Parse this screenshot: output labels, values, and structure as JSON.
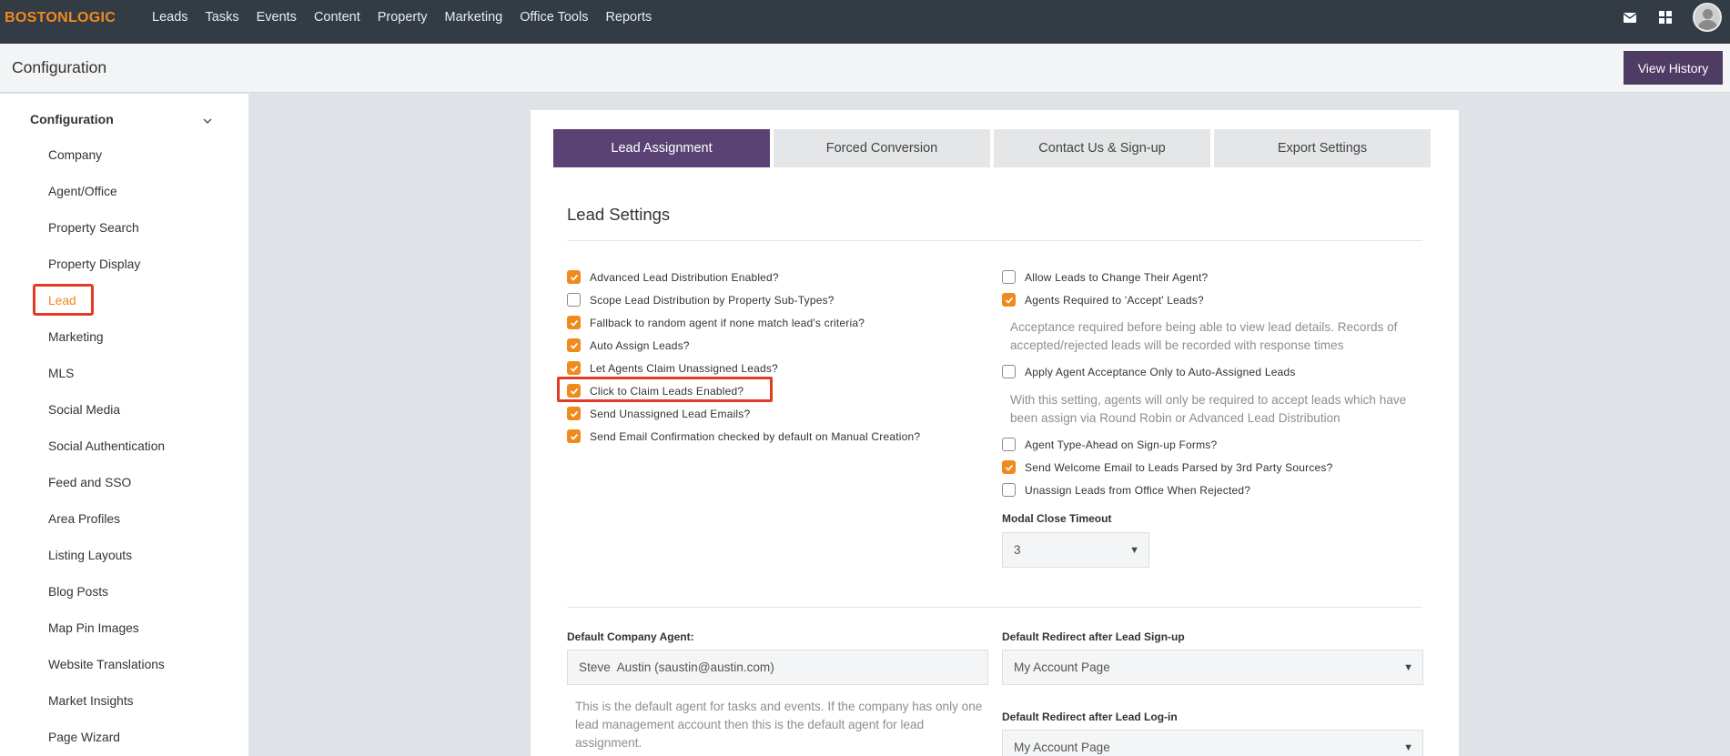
{
  "brand": {
    "logo_text": "BOSTONLOGIC"
  },
  "nav": {
    "items": [
      {
        "label": "Leads"
      },
      {
        "label": "Tasks"
      },
      {
        "label": "Events"
      },
      {
        "label": "Content"
      },
      {
        "label": "Property"
      },
      {
        "label": "Marketing"
      },
      {
        "label": "Office Tools"
      },
      {
        "label": "Reports"
      }
    ],
    "icons": [
      "envelope-icon",
      "grid-icon",
      "avatar"
    ]
  },
  "header": {
    "title": "Configuration",
    "view_history": "View History"
  },
  "sidebar": {
    "heading": "Configuration",
    "items": [
      {
        "label": "Company"
      },
      {
        "label": "Agent/Office"
      },
      {
        "label": "Property Search"
      },
      {
        "label": "Property Display"
      },
      {
        "label": "Lead",
        "active": true
      },
      {
        "label": "Marketing"
      },
      {
        "label": "MLS"
      },
      {
        "label": "Social Media"
      },
      {
        "label": "Social Authentication"
      },
      {
        "label": "Feed and SSO"
      },
      {
        "label": "Area Profiles"
      },
      {
        "label": "Listing Layouts"
      },
      {
        "label": "Blog Posts"
      },
      {
        "label": "Map Pin Images"
      },
      {
        "label": "Website Translations"
      },
      {
        "label": "Market Insights"
      },
      {
        "label": "Page Wizard"
      }
    ]
  },
  "tabs": [
    {
      "label": "Lead Assignment",
      "active": true
    },
    {
      "label": "Forced Conversion"
    },
    {
      "label": "Contact Us & Sign-up"
    },
    {
      "label": "Export Settings"
    }
  ],
  "lead_settings": {
    "title": "Lead Settings",
    "left": [
      {
        "label": "Advanced Lead Distribution Enabled?",
        "checked": true
      },
      {
        "label": "Scope Lead Distribution by Property Sub-Types?",
        "checked": false
      },
      {
        "label": "Fallback to random agent if none match lead's criteria?",
        "checked": true
      },
      {
        "label": "Auto Assign Leads?",
        "checked": true
      },
      {
        "label": "Let Agents Claim Unassigned Leads?",
        "checked": true
      },
      {
        "label": "Click to Claim Leads Enabled?",
        "checked": true
      },
      {
        "label": "Send Unassigned Lead Emails?",
        "checked": true
      },
      {
        "label": "Send Email Confirmation checked by default on Manual Creation?",
        "checked": true
      }
    ],
    "right": {
      "allow_change": {
        "label": "Allow Leads to Change Their Agent?",
        "checked": false
      },
      "agents_accept": {
        "label": "Agents Required to 'Accept' Leads?",
        "checked": true
      },
      "acceptance_help": "Acceptance required before being able to view lead details. Records of accepted/rejected leads will be recorded with response times",
      "apply_auto": {
        "label": "Apply Agent Acceptance Only to Auto-Assigned Leads",
        "checked": false
      },
      "apply_help": "With this setting, agents will only be required to accept leads which have been assign via Round Robin or Advanced Lead Distribution",
      "typeahead": {
        "label": "Agent Type-Ahead on Sign-up Forms?",
        "checked": false
      },
      "welcome_email": {
        "label": "Send Welcome Email to Leads Parsed by 3rd Party Sources?",
        "checked": true
      },
      "unassign": {
        "label": "Unassign Leads from Office When Rejected?",
        "checked": false
      },
      "modal_label": "Modal Close Timeout",
      "modal_value": "3"
    }
  },
  "defaults": {
    "agent_label": "Default Company Agent:",
    "agent_value": "Steve  Austin (saustin@austin.com)",
    "agent_help": "This is the default agent for tasks and events. If the company has only one lead management account then this is the default agent for lead assignment.",
    "redirect_signup_label": "Default Redirect after Lead Sign-up",
    "redirect_signup_value": "My Account Page",
    "redirect_login_label": "Default Redirect after Lead Log-in",
    "redirect_login_value": "My Account Page"
  },
  "colors": {
    "accent": "#f08a1d",
    "brand_purple": "#5a4374",
    "highlight_red": "#e23b25"
  }
}
